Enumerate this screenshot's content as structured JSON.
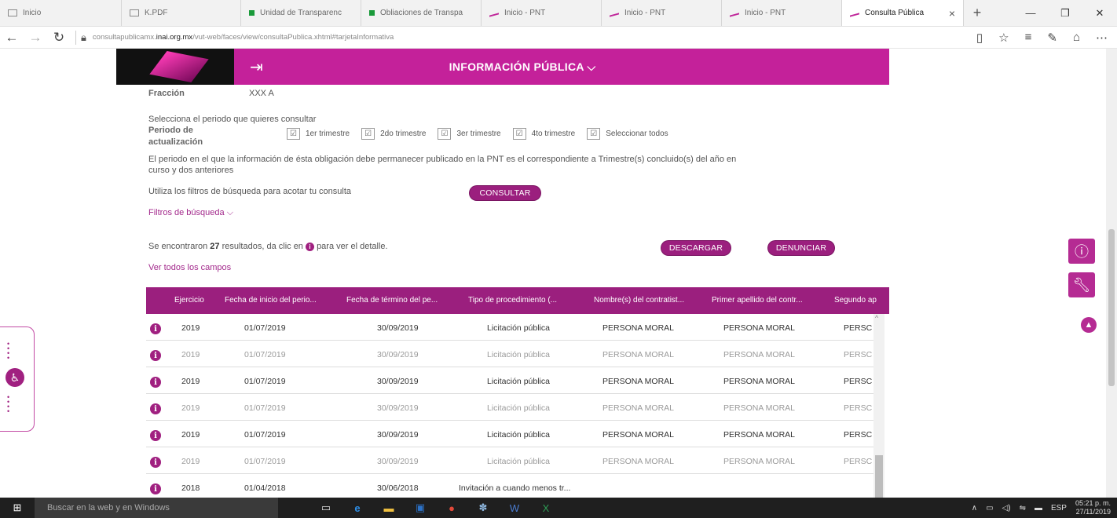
{
  "browser": {
    "tabs": [
      {
        "label": "Inicio",
        "icon": "page-icon"
      },
      {
        "label": "K.PDF",
        "icon": "page-icon"
      },
      {
        "label": "Unidad de Transparenc",
        "icon": "green-square-icon"
      },
      {
        "label": "Obliaciones de Transpa",
        "icon": "green-square-icon"
      },
      {
        "label": "Inicio - PNT",
        "icon": "pnt-icon"
      },
      {
        "label": "Inicio - PNT",
        "icon": "pnt-icon"
      },
      {
        "label": "Inicio - PNT",
        "icon": "pnt-icon"
      },
      {
        "label": "Consulta Pública",
        "icon": "pnt-icon",
        "active": true
      }
    ],
    "url_prefix": "consultapublicamx.",
    "url_domain": "inai.org.mx",
    "url_path": "/vut-web/faces/view/consultaPublica.xhtml#tarjetaInformativa"
  },
  "header": {
    "title": "INFORMACIÓN PÚBLICA",
    "brand_color": "#c4219a"
  },
  "form": {
    "fraccion_label": "Fracción",
    "fraccion_value": "XXX A",
    "periodo_prompt": "Selecciona el periodo que quieres consultar",
    "periodo_label_1": "Periodo de",
    "periodo_label_2": "actualización",
    "checkboxes": [
      "1er trimestre",
      "2do trimestre",
      "3er trimestre",
      "4to trimestre",
      "Seleccionar todos"
    ],
    "periodo_note_1": "El periodo en el que la información de ésta obligación debe permanecer publicado en la PNT es el correspondiente a Trimestre(s) concluido(s) del año en",
    "periodo_note_2": "curso y dos anteriores",
    "filtros_hint": "Utiliza los filtros de búsqueda para acotar tu consulta",
    "consultar": "CONSULTAR",
    "filtros_link": "Filtros de búsqueda"
  },
  "results": {
    "prefix": "Se encontraron",
    "count": "27",
    "middle": "resultados, da clic en",
    "suffix": "para ver el detalle.",
    "descargar": "DESCARGAR",
    "denunciar": "DENUNCIAR",
    "ver_todos": "Ver todos los campos"
  },
  "table": {
    "columns": [
      "Ejercicio",
      "Fecha de inicio del perio...",
      "Fecha de término del pe...",
      "Tipo de procedimiento (...",
      "Nombre(s) del contratist...",
      "Primer apellido del contr...",
      "Segundo ap"
    ],
    "rows": [
      [
        "2019",
        "01/07/2019",
        "30/09/2019",
        "Licitación pública",
        "PERSONA MORAL",
        "PERSONA MORAL",
        "PERSC"
      ],
      [
        "2019",
        "01/07/2019",
        "30/09/2019",
        "Licitación pública",
        "PERSONA MORAL",
        "PERSONA MORAL",
        "PERSC"
      ],
      [
        "2019",
        "01/07/2019",
        "30/09/2019",
        "Licitación pública",
        "PERSONA MORAL",
        "PERSONA MORAL",
        "PERSC"
      ],
      [
        "2019",
        "01/07/2019",
        "30/09/2019",
        "Licitación pública",
        "PERSONA MORAL",
        "PERSONA MORAL",
        "PERSC"
      ],
      [
        "2019",
        "01/07/2019",
        "30/09/2019",
        "Licitación pública",
        "PERSONA MORAL",
        "PERSONA MORAL",
        "PERSC"
      ],
      [
        "2019",
        "01/07/2019",
        "30/09/2019",
        "Licitación pública",
        "PERSONA MORAL",
        "PERSONA MORAL",
        "PERSC"
      ],
      [
        "2018",
        "01/04/2018",
        "30/06/2018",
        "Invitación a cuando menos tr...",
        "",
        "",
        ""
      ]
    ]
  },
  "taskbar": {
    "search_placeholder": "Buscar en la web y en Windows",
    "language": "ESP",
    "time": "05:21 p. m.",
    "date": "27/11/2019"
  }
}
